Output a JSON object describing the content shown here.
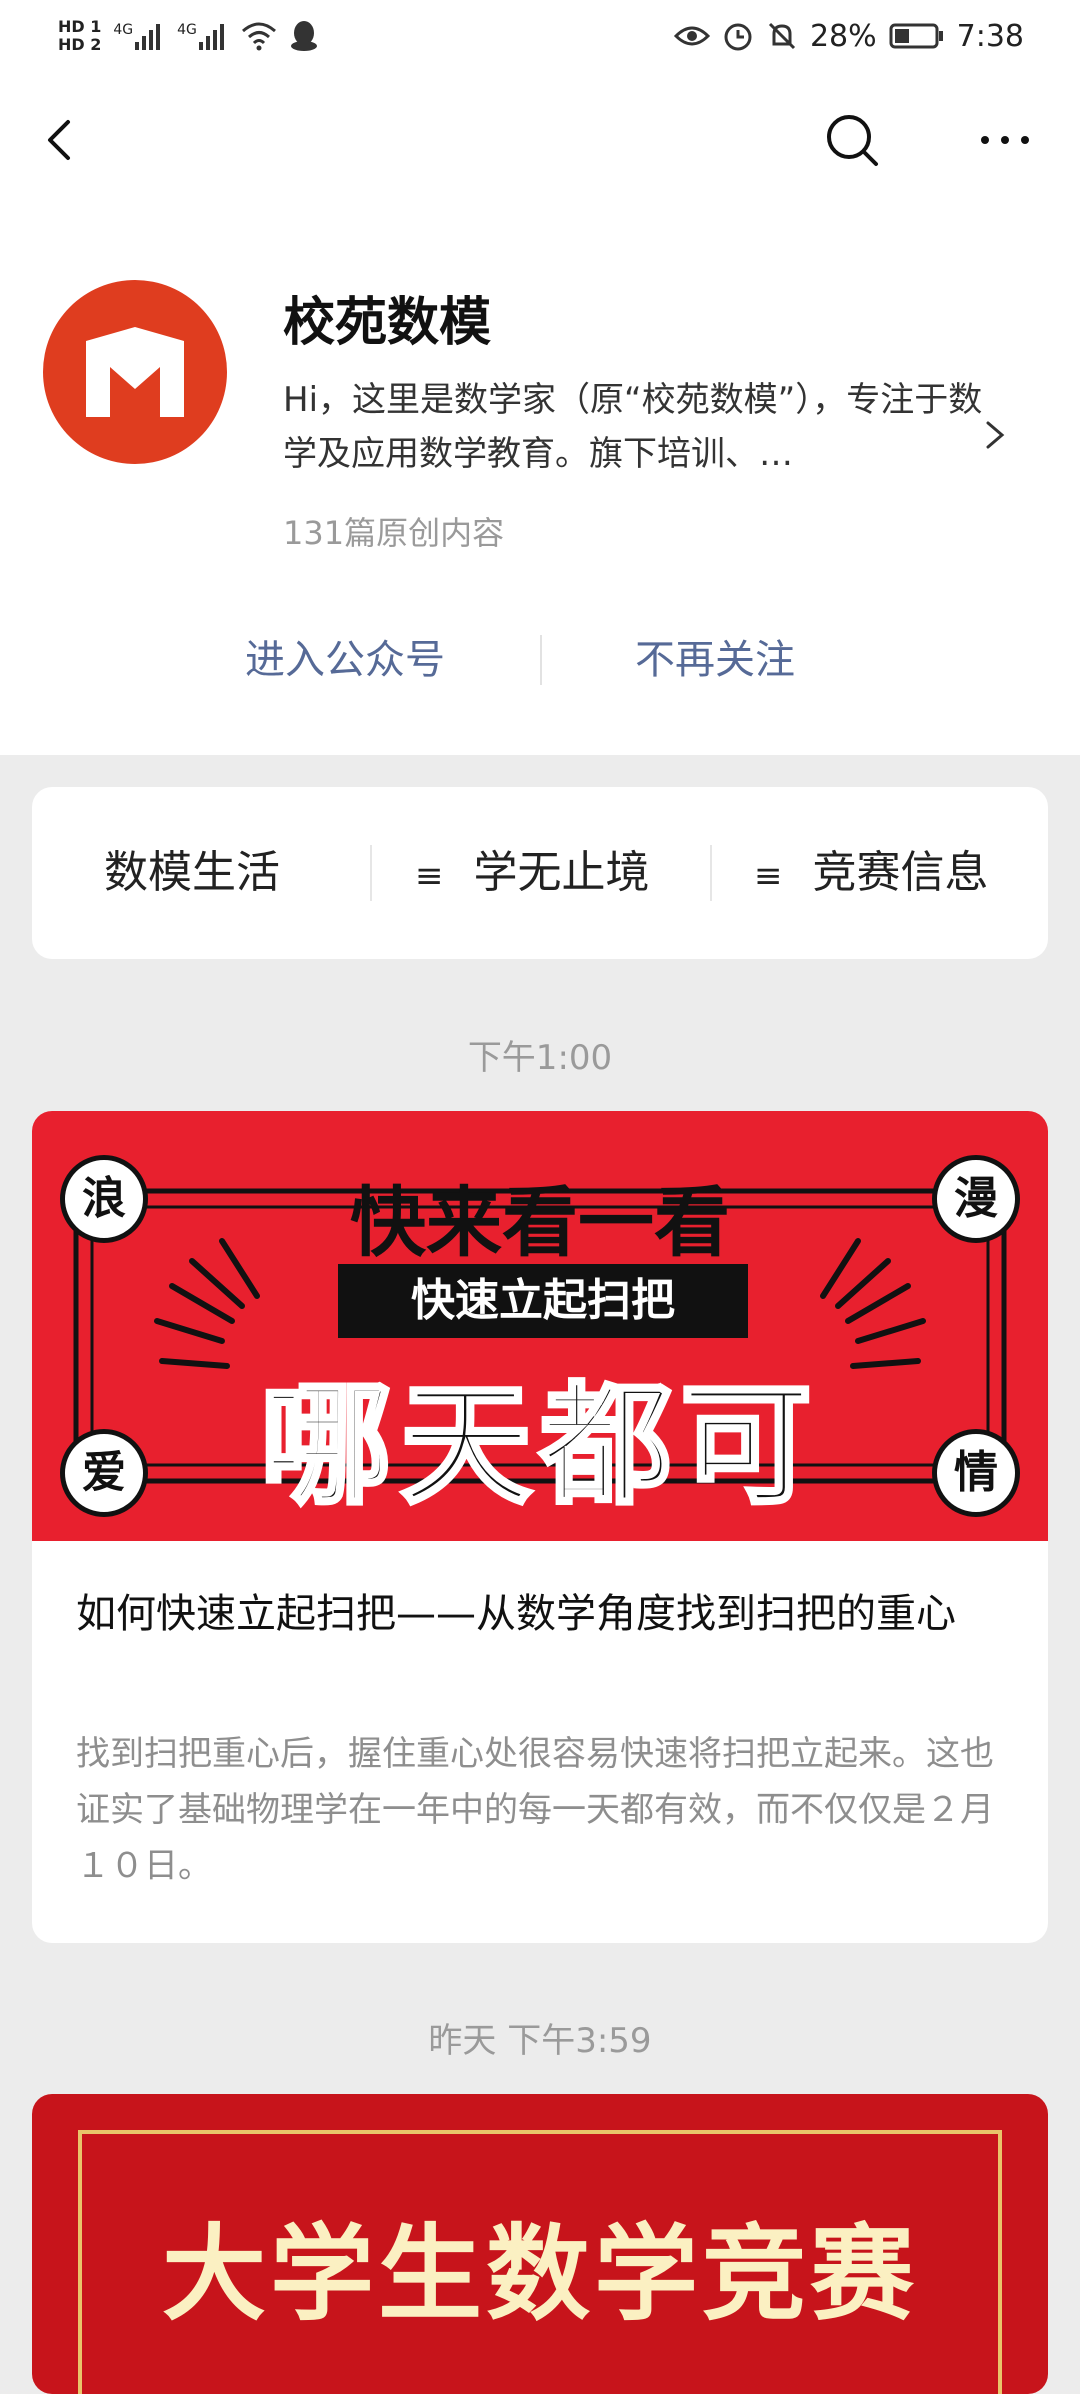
{
  "status_bar": {
    "hd1": "HD 1",
    "hd2": "HD 2",
    "signal1": "4G",
    "signal2": "4G",
    "battery": "28%",
    "time": "7:38"
  },
  "nav": {
    "icons": [
      "back-arrow-icon",
      "search-icon",
      "more-icon"
    ]
  },
  "account": {
    "name": "校苑数模",
    "description": "Hi，这里是数学家（原“校苑数模”），专注于数学及应用数学教育。旗下培训、…",
    "original_count": "131篇原创内容",
    "enter_label": "进入公众号",
    "unfollow_label": "不再关注",
    "avatar_color": "#df3d1f"
  },
  "menu": {
    "items": [
      {
        "label": "数模生活",
        "submenu": false
      },
      {
        "label": "学无止境",
        "submenu": true
      },
      {
        "label": "竞赛信息",
        "submenu": true
      }
    ]
  },
  "feed": {
    "posts": [
      {
        "time": "下午1:00",
        "banner": {
          "headline": "快来看一看",
          "subline": "快速立起扫把",
          "big": "哪天都可",
          "corners": [
            "浪",
            "漫",
            "爱",
            "情"
          ],
          "bg_color": "#e8202e"
        },
        "title": "如何快速立起扫把——从数学角度找到扫把的重心",
        "summary": "找到扫把重心后，握住重心处很容易快速将扫把立起来。这也证实了基础物理学在一年中的每一天都有效，而不仅仅是２月１０日。"
      },
      {
        "time": "昨天 下午3:59",
        "banner": {
          "big": "大学生数学竞赛",
          "bg_color": "#c7141b"
        }
      }
    ]
  }
}
